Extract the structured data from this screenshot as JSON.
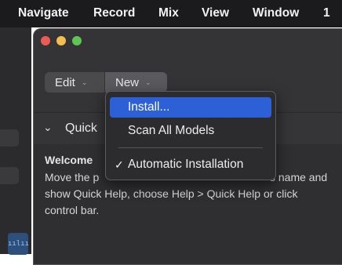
{
  "menubar": {
    "items": [
      {
        "label": "Navigate"
      },
      {
        "label": "Record"
      },
      {
        "label": "Mix"
      },
      {
        "label": "View"
      },
      {
        "label": "Window"
      },
      {
        "label": "1"
      }
    ]
  },
  "window": {
    "toolbar": {
      "edit_label": "Edit",
      "new_label": "New"
    },
    "quick_help": {
      "title": "Quick",
      "welcome": "Welcome",
      "lines": [
        "Move the p",
        "s name and",
        "show Quick Help, choose Help > Quick Help or click",
        "control bar."
      ]
    }
  },
  "new_menu": {
    "items": [
      {
        "label": "Install...",
        "highlighted": true
      },
      {
        "label": "Scan All Models"
      },
      {
        "label": "Automatic Installation",
        "checked": true,
        "checkmark": "✓"
      }
    ]
  },
  "colors": {
    "menubar_bg": "#1b1b1e",
    "window_bg": "#343436",
    "menu_highlight": "#2d5fd7"
  }
}
